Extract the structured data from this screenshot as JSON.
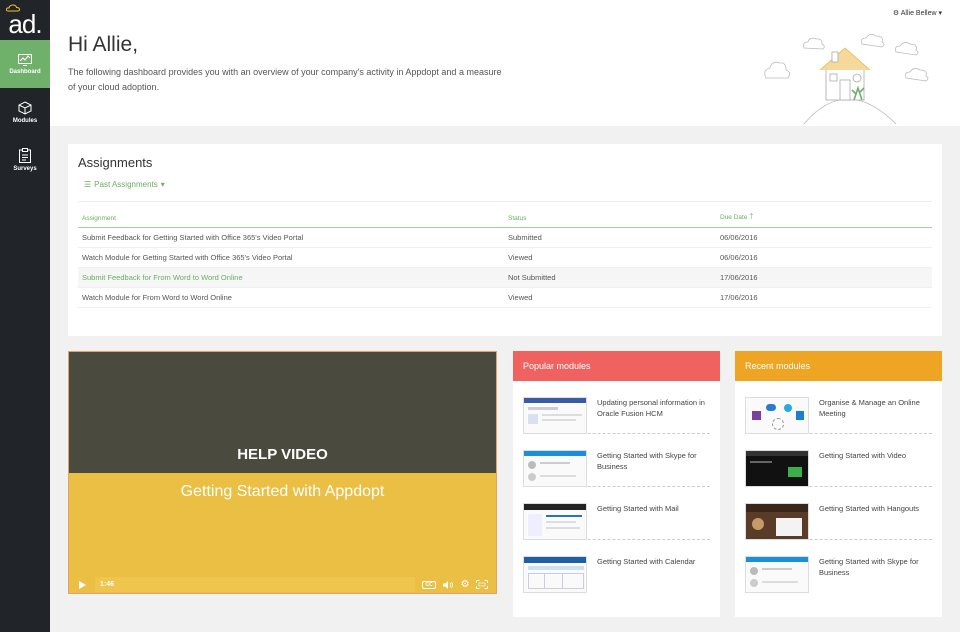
{
  "app": {
    "logo_text": "ad.",
    "user_name": "Allie Bellew"
  },
  "sidebar": {
    "items": [
      {
        "label": "Dashboard",
        "icon": "dashboard-icon",
        "active": true
      },
      {
        "label": "Modules",
        "icon": "cube-icon",
        "active": false
      },
      {
        "label": "Surveys",
        "icon": "clipboard-icon",
        "active": false
      }
    ]
  },
  "header": {
    "greeting": "Hi Allie,",
    "intro": "The following dashboard provides you with an overview of your company's activity in Appdopt and a measure of your cloud adoption."
  },
  "assignments": {
    "title": "Assignments",
    "filter_label": "Past Assignments",
    "columns": [
      "Assignment",
      "Status",
      "Due Date"
    ],
    "rows": [
      {
        "assignment": "Submit Feedback for Getting Started with Office 365's Video Portal",
        "status": "Submitted",
        "due": "06/06/2016",
        "link": false
      },
      {
        "assignment": "Watch Module for Getting Started with Office 365's Video Portal",
        "status": "Viewed",
        "due": "06/06/2016",
        "link": false
      },
      {
        "assignment": "Submit Feedback for From Word to Word Online",
        "status": "Not Submitted",
        "due": "17/06/2016",
        "link": true
      },
      {
        "assignment": "Watch Module for From Word to Word Online",
        "status": "Viewed",
        "due": "17/06/2016",
        "link": false
      }
    ]
  },
  "video": {
    "heading": "HELP VIDEO",
    "subtitle": "Getting Started with Appdopt",
    "time": "1:46",
    "cc_label": "CC"
  },
  "popular": {
    "title": "Popular modules",
    "items": [
      "Updating personal information in Oracle Fusion HCM",
      "Getting Started with Skype for Business",
      "Getting Started with Mail",
      "Getting Started with Calendar"
    ]
  },
  "recent": {
    "title": "Recent modules",
    "items": [
      "Organise & Manage an Online Meeting",
      "Getting Started with Video",
      "Getting Started with Hangouts",
      "Getting Started with Skype for Business"
    ]
  },
  "colors": {
    "accent_green": "#6fb16a",
    "popular_red": "#f0625f",
    "recent_orange": "#eea524",
    "sidebar_dark": "#212529"
  }
}
